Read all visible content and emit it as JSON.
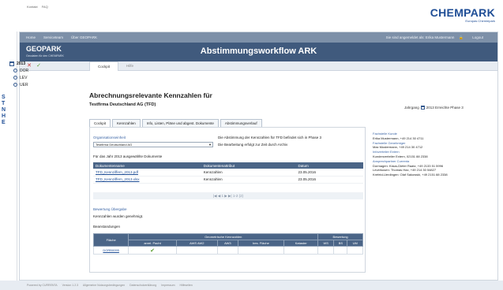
{
  "top_links": [
    "Kontakt",
    "FAQ"
  ],
  "brand": {
    "name": "CHEMPARK",
    "sub": "Europas Chemiepark"
  },
  "side_logo": [
    "S",
    "T",
    "N",
    "H",
    "E"
  ],
  "nav": {
    "items": [
      "Home",
      "Serviceteam",
      "Über GEOPARK"
    ],
    "right": "Sie sind angemeldet als: Erika Mustermann",
    "logout": "Logout"
  },
  "app_header": {
    "logo": "GEOPARK",
    "sub": "Geodaten für den CHEMPARK",
    "title": "Abstimmungsworkflow ARK"
  },
  "toolbar": {
    "tabs": [
      "Cockpit",
      "Hilfe"
    ]
  },
  "tree": {
    "year": "2013",
    "children": [
      "DOR",
      "LEV",
      "UER"
    ]
  },
  "main": {
    "title": "Abrechnungsrelevante Kennzahlen für",
    "subtitle": "Testfirma Deutschland AG (TFD)",
    "jahrgang_label": "Jahrgang",
    "jahrgang_value": "2013 Erreichte Phase 3"
  },
  "inner_tabs": [
    "Cockpit",
    "Kennzahlen",
    "Info, Listen, Pläne und abgest. Dokumente",
    "Abstimmungsverlauf"
  ],
  "cockpit": {
    "org_label": "Organisationseinheit",
    "org_value": "Testfirma Deutschland AG",
    "phase_text": "Die Abstimmung der Kennzahlen für TFD befindet sich in Phase 3",
    "bearbeitung_text": "Die Bearbeitung erfolgt zur Zeit durch Archiv",
    "docs_heading": "Für das Jahr 2013 ausgewählte Dokumente",
    "doc_columns": [
      "Dokumentenname",
      "Dokumentenattribut",
      "Datum"
    ],
    "docs": [
      {
        "name": "TFD_Kennziffern_2013.pdf",
        "attr": "Kennzahlen",
        "date": "23.05.2016"
      },
      {
        "name": "TFD_Kennziffern_2013.xlsx",
        "attr": "Kennzahlen",
        "date": "23.05.2016"
      }
    ],
    "pager": "|◀  ◀  1  ▶  ▶|   1-2 (2)",
    "bewertung_label": "Bewertung Übergabe",
    "bewertung_text": "Kennzahlen wurden genehmigt.",
    "beanstandungen_label": "Beanstandungen",
    "geo_group": "Geometrische Kennzahlen",
    "bew_group": "Bewertung",
    "geo_columns": [
      "Fläche",
      "anrel. Pacht",
      "AWS AW2",
      "AW3",
      "bes. Fläche",
      "Kataster",
      "WS",
      "BS",
      "UM"
    ],
    "geo_rows": [
      {
        "flaeche": "DORB0095"
      }
    ]
  },
  "right_panel": [
    {
      "text": "Fachstelle Kunde",
      "head": true
    },
    {
      "text": "Erika Mustermann, +49 214 30 4711",
      "head": false
    },
    {
      "text": "Fachstelle Genehmiger",
      "head": true
    },
    {
      "text": "Max Mustermann, +49 214 30 4712",
      "head": false
    },
    {
      "text": "Infoverteiler Extern",
      "head": true
    },
    {
      "text": "Kundenverteiler Extern, 02151 88 2338",
      "head": false
    },
    {
      "text": "Ansprechpartner Currenta",
      "head": true
    },
    {
      "text": "Dormagen: Klaus-Dieter Raatz, +49 2133 51 5996",
      "head": false
    },
    {
      "text": "Leverkusen: Thomas Hax, +49 214 30 54827",
      "head": false
    },
    {
      "text": "Krefeld-Uerdingen: Olaf Sakowski, +49 2151 88 2338",
      "head": false
    }
  ],
  "footer": [
    "Powered by CURRENTA",
    "Version 1.2.3",
    "Allgemeine Nutzungsbedingungen",
    "Datenschutzerklärung",
    "Impressum",
    "Hilfeseiten"
  ]
}
